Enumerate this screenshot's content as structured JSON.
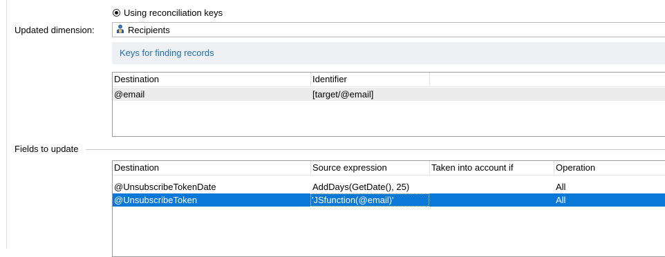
{
  "reconciliation": {
    "radio_label": "Using reconciliation keys"
  },
  "dimension": {
    "label": "Updated dimension:",
    "value": "Recipients",
    "icon": "person-icon"
  },
  "keys": {
    "link_label": "Keys for finding records",
    "columns": [
      "Destination",
      "Identifier"
    ],
    "rows": [
      {
        "destination": "@email",
        "identifier": "[target/@email]"
      }
    ]
  },
  "fields": {
    "section_label": "Fields to update",
    "columns": [
      "Destination",
      "Source expression",
      "Taken into account if",
      "Operation"
    ],
    "rows": [
      {
        "destination": "@UnsubscribeTokenDate",
        "source": "AddDays(GetDate(), 25)",
        "condition": "",
        "operation": "All"
      },
      {
        "destination": "@UnsubscribeToken",
        "source": "'JSfunction(@email)'",
        "condition": "",
        "operation": "All"
      }
    ]
  },
  "colors": {
    "selection": "#0a78d7",
    "link": "#1f6fb3",
    "alt_row": "#ececec"
  }
}
